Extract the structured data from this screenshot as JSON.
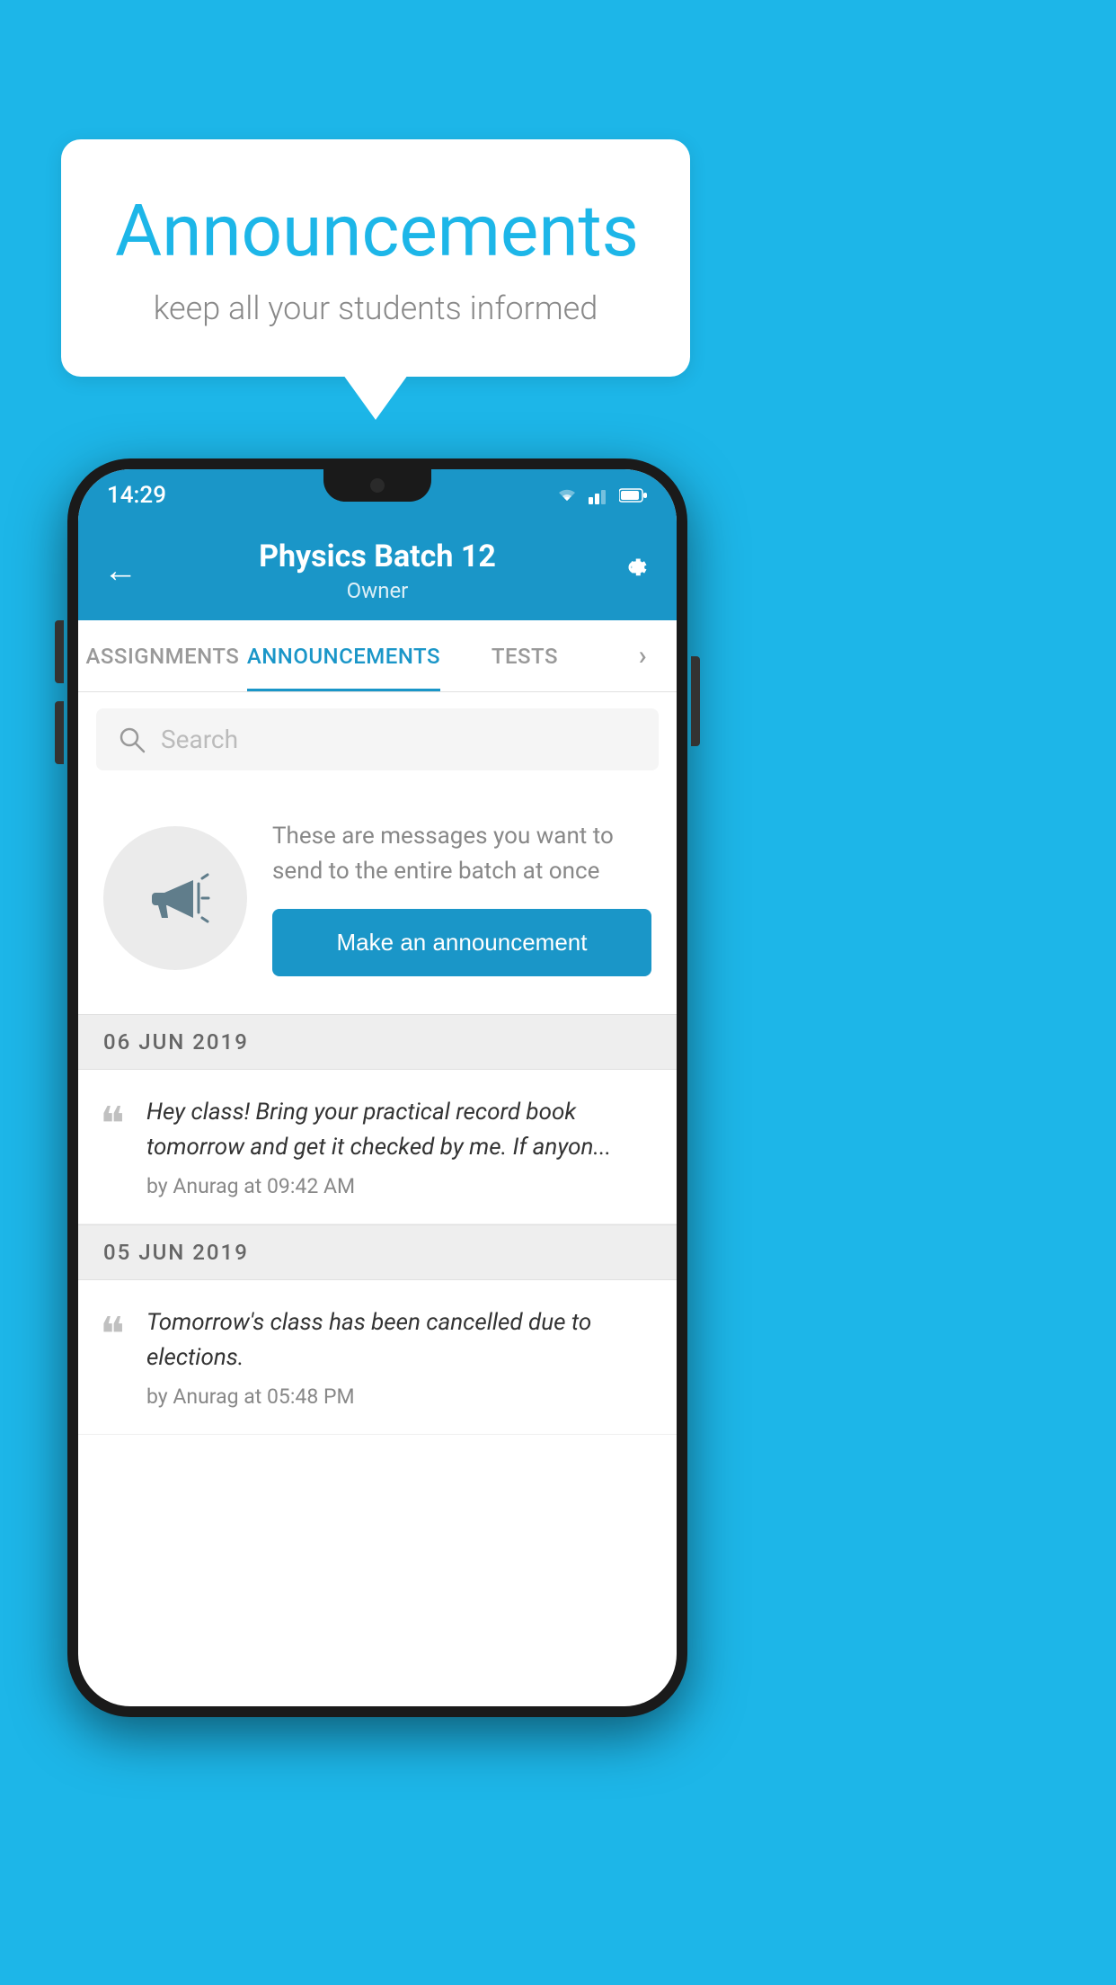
{
  "background": {
    "color": "#1db6e8"
  },
  "speech_bubble": {
    "title": "Announcements",
    "subtitle": "keep all your students informed"
  },
  "phone": {
    "status_bar": {
      "time": "14:29"
    },
    "app_bar": {
      "title": "Physics Batch 12",
      "subtitle": "Owner",
      "back_label": "←",
      "settings_label": "⚙"
    },
    "tabs": [
      {
        "label": "ASSIGNMENTS",
        "active": false
      },
      {
        "label": "ANNOUNCEMENTS",
        "active": true
      },
      {
        "label": "TESTS",
        "active": false
      },
      {
        "label": "›",
        "active": false
      }
    ],
    "search": {
      "placeholder": "Search"
    },
    "announce_prompt": {
      "description": "These are messages you want to send to the entire batch at once",
      "button_label": "Make an announcement"
    },
    "announcements": [
      {
        "date": "06  JUN  2019",
        "text": "Hey class! Bring your practical record book tomorrow and get it checked by me. If anyon...",
        "meta": "by Anurag at 09:42 AM"
      },
      {
        "date": "05  JUN  2019",
        "text": "Tomorrow's class has been cancelled due to elections.",
        "meta": "by Anurag at 05:48 PM"
      }
    ]
  }
}
